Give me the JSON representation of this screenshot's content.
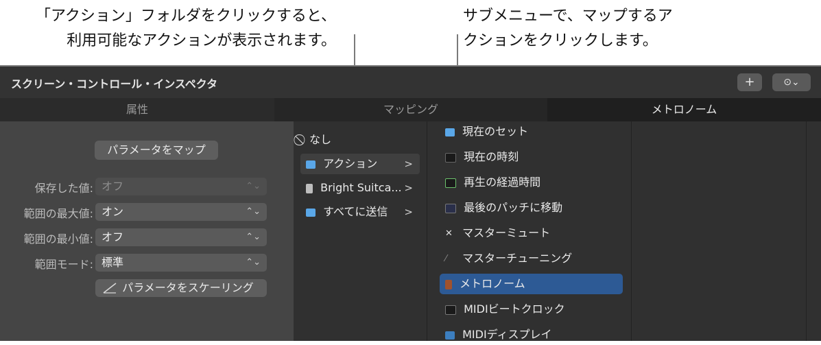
{
  "callouts": {
    "left_line1": "「アクション」フォルダをクリックすると、",
    "left_line2": "利用可能なアクションが表示されます。",
    "right_line1": "サブメニューで、マップするア",
    "right_line2": "クションをクリックします。"
  },
  "window": {
    "title": "スクリーン・コントロール・インスペクタ",
    "add_label": "+",
    "more_label": "⊙⌄"
  },
  "tabs": [
    "属性",
    "マッピング",
    "メトロノーム"
  ],
  "left_panel": {
    "map_button": "パラメータをマップ",
    "fields": [
      {
        "label": "保存した値:",
        "value": "オフ",
        "disabled": true
      },
      {
        "label": "範囲の最大値:",
        "value": "オン",
        "disabled": false
      },
      {
        "label": "範囲の最小値:",
        "value": "オフ",
        "disabled": false
      },
      {
        "label": "範囲モード:",
        "value": "標準",
        "disabled": false
      }
    ],
    "scale_button": "パラメータをスケーリング"
  },
  "column1": {
    "items": [
      {
        "label": "なし",
        "icon": "prohibited-icon",
        "arrow": ""
      },
      {
        "label": "アクション",
        "icon": "folder-icon",
        "arrow": ">"
      },
      {
        "label": "Bright Suitca...",
        "icon": "instrument-icon",
        "arrow": ">"
      },
      {
        "label": "すべてに送信",
        "icon": "folder-send-icon",
        "arrow": ">"
      }
    ]
  },
  "column2": {
    "items": [
      {
        "label": "現在のセット",
        "icon": "folder-icon"
      },
      {
        "label": "現在の時刻",
        "icon": "clock-icon"
      },
      {
        "label": "再生の経過時間",
        "icon": "elapsed-icon"
      },
      {
        "label": "最後のパッチに移動",
        "icon": "patch-icon"
      },
      {
        "label": "マスターミュート",
        "icon": "mute-icon"
      },
      {
        "label": "マスターチューニング",
        "icon": "tuning-icon"
      },
      {
        "label": "メトロノーム",
        "icon": "metronome-icon"
      },
      {
        "label": "MIDIビートクロック",
        "icon": "midi-clock-icon"
      },
      {
        "label": "MIDIディスプレイ",
        "icon": "midi-display-icon"
      }
    ]
  },
  "colors": {
    "accent": "#2d5a95",
    "folder": "#5aa7e8"
  }
}
